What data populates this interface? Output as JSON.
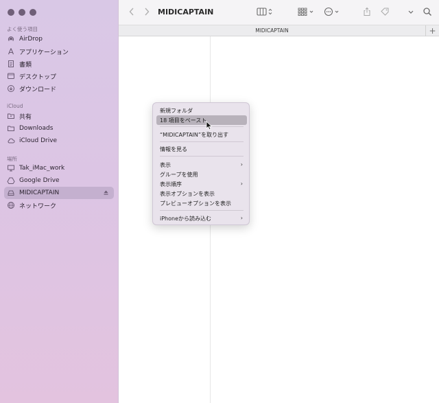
{
  "window": {
    "title": "MIDICAPTAIN",
    "tab_label": "MIDICAPTAIN",
    "tab_add": "+"
  },
  "sidebar": {
    "section_favorites": "よく使う項目",
    "section_icloud": "iCloud",
    "section_locations": "場所",
    "favorites": [
      {
        "label": "AirDrop",
        "icon": "airdrop-icon"
      },
      {
        "label": "アプリケーション",
        "icon": "applications-icon"
      },
      {
        "label": "書類",
        "icon": "document-icon"
      },
      {
        "label": "デスクトップ",
        "icon": "desktop-icon"
      },
      {
        "label": "ダウンロード",
        "icon": "download-icon"
      }
    ],
    "icloud": [
      {
        "label": "共有",
        "icon": "shared-folder-icon"
      },
      {
        "label": "Downloads",
        "icon": "folder-icon"
      },
      {
        "label": "iCloud Drive",
        "icon": "cloud-icon"
      }
    ],
    "locations": [
      {
        "label": "Tak_iMac_work",
        "icon": "computer-icon"
      },
      {
        "label": "Google Drive",
        "icon": "drive-icon"
      },
      {
        "label": "MIDICAPTAIN",
        "icon": "drive-icon",
        "selected": true
      },
      {
        "label": "ネットワーク",
        "icon": "network-icon"
      }
    ]
  },
  "context_menu": {
    "items": [
      {
        "label": "新規フォルダ"
      },
      {
        "label": "18 項目をペースト",
        "highlighted": true
      },
      {
        "label": "“MIDICAPTAIN”を取り出す"
      },
      {
        "label": "情報を見る"
      },
      {
        "label": "表示",
        "submenu": true
      },
      {
        "label": "グループを使用"
      },
      {
        "label": "表示順序",
        "submenu": true
      },
      {
        "label": "表示オプションを表示"
      },
      {
        "label": "プレビューオプションを表示"
      },
      {
        "label": "iPhoneから読み込む",
        "submenu": true
      }
    ],
    "submenu_glyph": "›"
  }
}
